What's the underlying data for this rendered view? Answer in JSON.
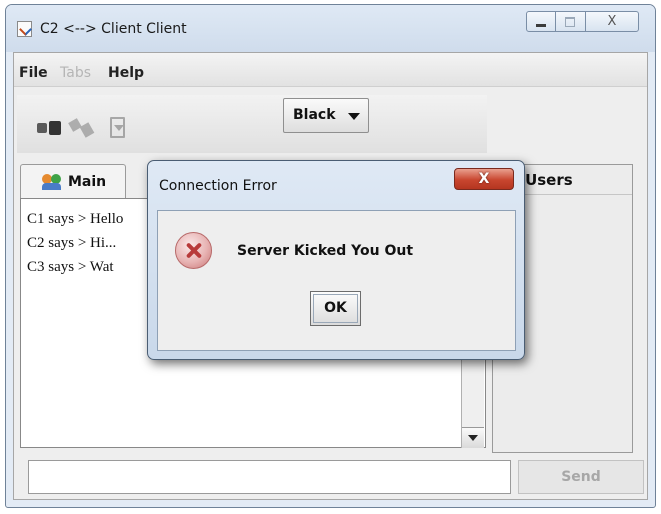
{
  "window": {
    "title": "C2 <--> Client Client"
  },
  "menu": {
    "file": "File",
    "tabs": "Tabs",
    "help": "Help"
  },
  "toolbar": {
    "color_selected": "Black"
  },
  "tabs": {
    "main": "Main"
  },
  "chat": {
    "lines": [
      "C1 says > Hello",
      "C2 says > Hi...",
      "C3 says > Wat"
    ]
  },
  "users": {
    "title": "Online Users",
    "title_visible": "ne Users"
  },
  "input": {
    "value": "",
    "placeholder": ""
  },
  "send": {
    "label": "Send"
  },
  "dialog": {
    "title": "Connection Error",
    "message": "Server Kicked You Out",
    "ok_label": "OK",
    "close_label": "X"
  },
  "colors": {
    "titlebar": "#dfe9f5",
    "close_button": "#c8462f",
    "error_icon": "#b83a3a"
  },
  "icons": [
    "app-java-icon",
    "connect-icon",
    "disconnect-icon",
    "document-icon",
    "users-group-icon",
    "error-icon",
    "chevron-down-icon"
  ]
}
